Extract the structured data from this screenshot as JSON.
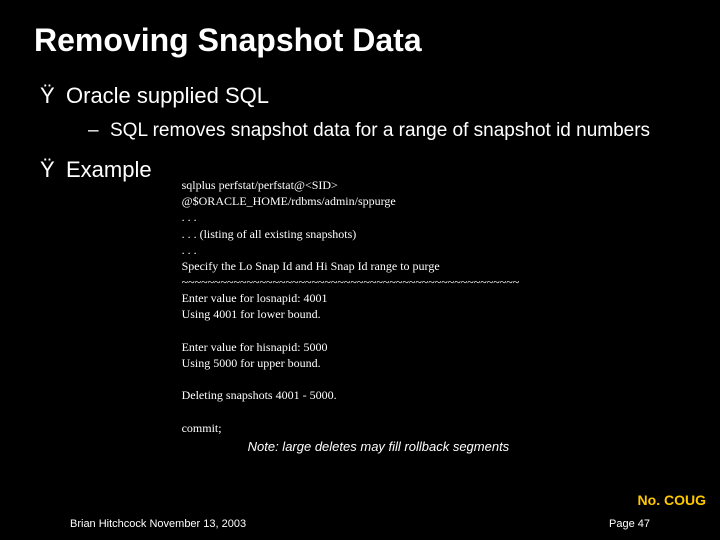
{
  "title": "Removing Snapshot Data",
  "bullet_mark": "Ÿ",
  "bullets": {
    "b1": "Oracle supplied SQL",
    "b2_dash": "–",
    "b2": "SQL removes snapshot data for a range of snapshot id numbers",
    "b3": "Example"
  },
  "code": {
    "l1": "sqlplus perfstat/perfstat@<SID>",
    "l2": "@$ORACLE_HOME/rdbms/admin/sppurge",
    "l3": ". . .",
    "l4": ". . . (listing of all existing snapshots)",
    "l5": ". . .",
    "l6": "Specify the Lo Snap Id and Hi Snap Id range to purge",
    "l7": "~~~~~~~~~~~~~~~~~~~~~~~~~~~~~~~~~~~~~~~~~~~~~~~~~~~~",
    "l8": "Enter value for losnapid: 4001",
    "l9": "Using 4001 for lower bound.",
    "l10": "",
    "l11": "Enter value for hisnapid: 5000",
    "l12": "Using 5000 for upper bound.",
    "l13": "",
    "l14": "Deleting snapshots 4001 - 5000.",
    "l15": "",
    "l16": "commit;"
  },
  "note": "Note: large deletes may fill rollback segments",
  "logo": "No. COUG",
  "footer": {
    "left": "Brian Hitchcock  November 13, 2003",
    "right": "Page 47"
  }
}
